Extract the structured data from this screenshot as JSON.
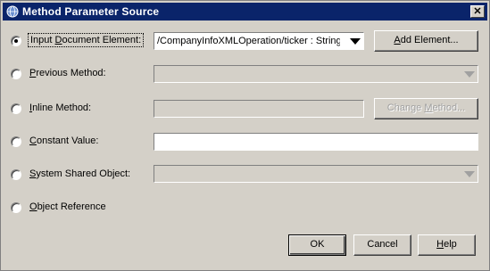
{
  "window": {
    "title": "Method Parameter Source",
    "close_glyph": "✕"
  },
  "options": [
    {
      "id": "input-document-element",
      "label_pre": "Input ",
      "label_key": "D",
      "label_post": "ocument Element:",
      "selected": true
    },
    {
      "id": "previous-method",
      "label_pre": "",
      "label_key": "P",
      "label_post": "revious Method:",
      "selected": false
    },
    {
      "id": "inline-method",
      "label_pre": "",
      "label_key": "I",
      "label_post": "nline Method:",
      "selected": false
    },
    {
      "id": "constant-value",
      "label_pre": "",
      "label_key": "C",
      "label_post": "onstant Value:",
      "selected": false
    },
    {
      "id": "system-shared-object",
      "label_pre": "",
      "label_key": "S",
      "label_post": "ystem Shared Object:",
      "selected": false
    },
    {
      "id": "object-reference",
      "label_pre": "",
      "label_key": "O",
      "label_post": "bject Reference",
      "selected": false
    }
  ],
  "input_document_element": {
    "selected_value": "/CompanyInfoXMLOperation/ticker : String",
    "add_button": {
      "pre": "",
      "key": "A",
      "post": "dd Element..."
    }
  },
  "inline_method": {
    "change_button": {
      "pre": "Change ",
      "key": "M",
      "post": "ethod..."
    }
  },
  "constant_value": {
    "value": ""
  },
  "footer": {
    "ok_label": "OK",
    "cancel_label": "Cancel",
    "help": {
      "pre": "",
      "key": "H",
      "post": "elp"
    }
  }
}
